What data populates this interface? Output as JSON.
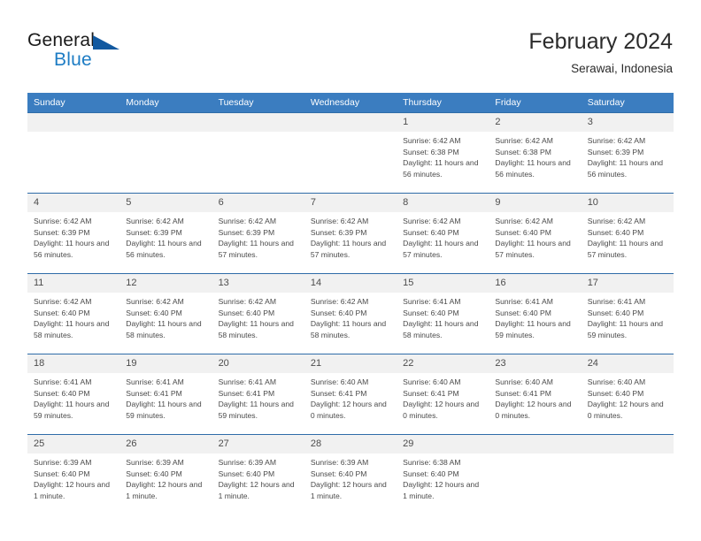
{
  "brand": {
    "name_part1": "General",
    "name_part2": "Blue"
  },
  "header": {
    "title": "February 2024",
    "location": "Serawai, Indonesia"
  },
  "weekday_headers": [
    "Sunday",
    "Monday",
    "Tuesday",
    "Wednesday",
    "Thursday",
    "Friday",
    "Saturday"
  ],
  "labels": {
    "sunrise_prefix": "Sunrise:",
    "sunset_prefix": "Sunset:",
    "daylight_prefix": "Daylight:"
  },
  "colors": {
    "header_blue": "#3b7dc0",
    "row_divider_blue": "#2f6ca8",
    "daynum_band": "#f1f1f1",
    "brand_blue": "#1d7cc4",
    "brand_triangle": "#1259a0"
  },
  "weeks": [
    [
      {
        "day": "",
        "blank": true
      },
      {
        "day": "",
        "blank": true
      },
      {
        "day": "",
        "blank": true
      },
      {
        "day": "",
        "blank": true
      },
      {
        "day": "1",
        "sunrise": "Sunrise: 6:42 AM",
        "sunset": "Sunset: 6:38 PM",
        "daylight": "Daylight: 11 hours and 56 minutes."
      },
      {
        "day": "2",
        "sunrise": "Sunrise: 6:42 AM",
        "sunset": "Sunset: 6:38 PM",
        "daylight": "Daylight: 11 hours and 56 minutes."
      },
      {
        "day": "3",
        "sunrise": "Sunrise: 6:42 AM",
        "sunset": "Sunset: 6:39 PM",
        "daylight": "Daylight: 11 hours and 56 minutes."
      }
    ],
    [
      {
        "day": "4",
        "sunrise": "Sunrise: 6:42 AM",
        "sunset": "Sunset: 6:39 PM",
        "daylight": "Daylight: 11 hours and 56 minutes."
      },
      {
        "day": "5",
        "sunrise": "Sunrise: 6:42 AM",
        "sunset": "Sunset: 6:39 PM",
        "daylight": "Daylight: 11 hours and 56 minutes."
      },
      {
        "day": "6",
        "sunrise": "Sunrise: 6:42 AM",
        "sunset": "Sunset: 6:39 PM",
        "daylight": "Daylight: 11 hours and 57 minutes."
      },
      {
        "day": "7",
        "sunrise": "Sunrise: 6:42 AM",
        "sunset": "Sunset: 6:39 PM",
        "daylight": "Daylight: 11 hours and 57 minutes."
      },
      {
        "day": "8",
        "sunrise": "Sunrise: 6:42 AM",
        "sunset": "Sunset: 6:40 PM",
        "daylight": "Daylight: 11 hours and 57 minutes."
      },
      {
        "day": "9",
        "sunrise": "Sunrise: 6:42 AM",
        "sunset": "Sunset: 6:40 PM",
        "daylight": "Daylight: 11 hours and 57 minutes."
      },
      {
        "day": "10",
        "sunrise": "Sunrise: 6:42 AM",
        "sunset": "Sunset: 6:40 PM",
        "daylight": "Daylight: 11 hours and 57 minutes."
      }
    ],
    [
      {
        "day": "11",
        "sunrise": "Sunrise: 6:42 AM",
        "sunset": "Sunset: 6:40 PM",
        "daylight": "Daylight: 11 hours and 58 minutes."
      },
      {
        "day": "12",
        "sunrise": "Sunrise: 6:42 AM",
        "sunset": "Sunset: 6:40 PM",
        "daylight": "Daylight: 11 hours and 58 minutes."
      },
      {
        "day": "13",
        "sunrise": "Sunrise: 6:42 AM",
        "sunset": "Sunset: 6:40 PM",
        "daylight": "Daylight: 11 hours and 58 minutes."
      },
      {
        "day": "14",
        "sunrise": "Sunrise: 6:42 AM",
        "sunset": "Sunset: 6:40 PM",
        "daylight": "Daylight: 11 hours and 58 minutes."
      },
      {
        "day": "15",
        "sunrise": "Sunrise: 6:41 AM",
        "sunset": "Sunset: 6:40 PM",
        "daylight": "Daylight: 11 hours and 58 minutes."
      },
      {
        "day": "16",
        "sunrise": "Sunrise: 6:41 AM",
        "sunset": "Sunset: 6:40 PM",
        "daylight": "Daylight: 11 hours and 59 minutes."
      },
      {
        "day": "17",
        "sunrise": "Sunrise: 6:41 AM",
        "sunset": "Sunset: 6:40 PM",
        "daylight": "Daylight: 11 hours and 59 minutes."
      }
    ],
    [
      {
        "day": "18",
        "sunrise": "Sunrise: 6:41 AM",
        "sunset": "Sunset: 6:40 PM",
        "daylight": "Daylight: 11 hours and 59 minutes."
      },
      {
        "day": "19",
        "sunrise": "Sunrise: 6:41 AM",
        "sunset": "Sunset: 6:41 PM",
        "daylight": "Daylight: 11 hours and 59 minutes."
      },
      {
        "day": "20",
        "sunrise": "Sunrise: 6:41 AM",
        "sunset": "Sunset: 6:41 PM",
        "daylight": "Daylight: 11 hours and 59 minutes."
      },
      {
        "day": "21",
        "sunrise": "Sunrise: 6:40 AM",
        "sunset": "Sunset: 6:41 PM",
        "daylight": "Daylight: 12 hours and 0 minutes."
      },
      {
        "day": "22",
        "sunrise": "Sunrise: 6:40 AM",
        "sunset": "Sunset: 6:41 PM",
        "daylight": "Daylight: 12 hours and 0 minutes."
      },
      {
        "day": "23",
        "sunrise": "Sunrise: 6:40 AM",
        "sunset": "Sunset: 6:41 PM",
        "daylight": "Daylight: 12 hours and 0 minutes."
      },
      {
        "day": "24",
        "sunrise": "Sunrise: 6:40 AM",
        "sunset": "Sunset: 6:40 PM",
        "daylight": "Daylight: 12 hours and 0 minutes."
      }
    ],
    [
      {
        "day": "25",
        "sunrise": "Sunrise: 6:39 AM",
        "sunset": "Sunset: 6:40 PM",
        "daylight": "Daylight: 12 hours and 1 minute."
      },
      {
        "day": "26",
        "sunrise": "Sunrise: 6:39 AM",
        "sunset": "Sunset: 6:40 PM",
        "daylight": "Daylight: 12 hours and 1 minute."
      },
      {
        "day": "27",
        "sunrise": "Sunrise: 6:39 AM",
        "sunset": "Sunset: 6:40 PM",
        "daylight": "Daylight: 12 hours and 1 minute."
      },
      {
        "day": "28",
        "sunrise": "Sunrise: 6:39 AM",
        "sunset": "Sunset: 6:40 PM",
        "daylight": "Daylight: 12 hours and 1 minute."
      },
      {
        "day": "29",
        "sunrise": "Sunrise: 6:38 AM",
        "sunset": "Sunset: 6:40 PM",
        "daylight": "Daylight: 12 hours and 1 minute."
      },
      {
        "day": "",
        "blank": true
      },
      {
        "day": "",
        "blank": true
      }
    ]
  ]
}
